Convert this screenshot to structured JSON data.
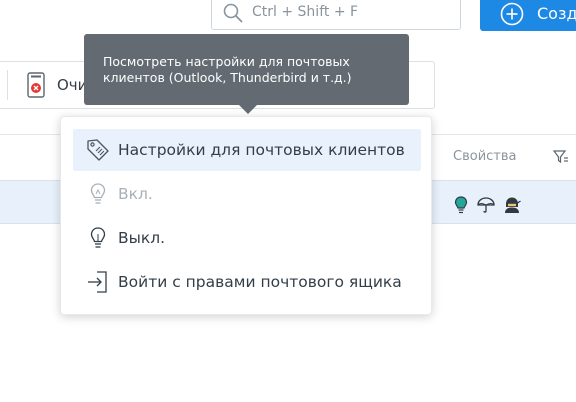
{
  "search": {
    "placeholder": "Ctrl + Shift + F"
  },
  "create_button": {
    "label": "Созд"
  },
  "toolbar": {
    "clear_label": "Очи"
  },
  "grid": {
    "properties_header": "Свойства"
  },
  "tooltip": {
    "text": "Посмотреть настройки для почтовых клиентов (Outlook, Thunderbird и т.д.)"
  },
  "menu": {
    "items": [
      {
        "label": "Настройки для почтовых клиентов",
        "icon": "mail-settings-tag-icon",
        "active": true
      },
      {
        "label": "Вкл.",
        "icon": "lightbulb-on-icon",
        "disabled": true
      },
      {
        "label": "Выкл.",
        "icon": "lightbulb-off-icon"
      },
      {
        "label": "Войти с правами почтового ящика",
        "icon": "login-icon"
      }
    ]
  },
  "row_icons": [
    "lightbulb-icon",
    "umbrella-icon",
    "ninja-icon"
  ],
  "colors": {
    "accent": "#1e88e5",
    "tooltip_bg": "#636a71",
    "row_highlight": "#e8f1fb",
    "menu_active": "#e9f2fc",
    "danger": "#e53935"
  }
}
